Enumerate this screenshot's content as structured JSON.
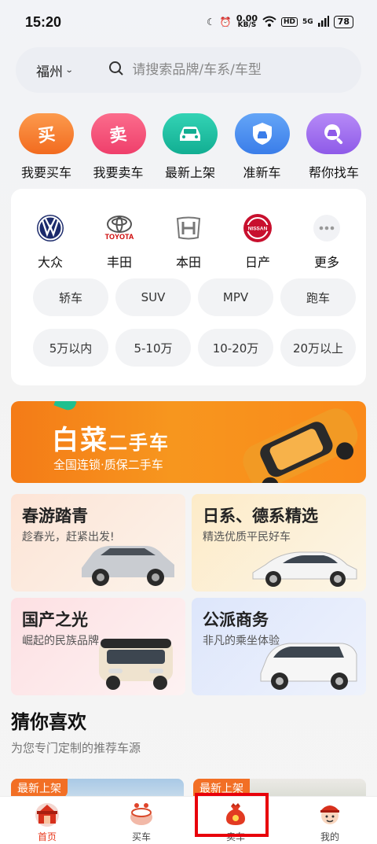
{
  "status": {
    "time": "15:20",
    "speed_value": "0.00",
    "speed_unit": "KB/S",
    "hd": "HD",
    "network": "5G",
    "battery": "78"
  },
  "search": {
    "city": "福州",
    "placeholder": "请搜索品牌/车系/车型"
  },
  "quick_actions": [
    {
      "label": "我要买车",
      "glyph": "买",
      "color": "#f7853a"
    },
    {
      "label": "我要卖车",
      "glyph": "卖",
      "color": "#f2557a"
    },
    {
      "label": "最新上架",
      "glyph": "car-icon",
      "color": "#1ec2a4"
    },
    {
      "label": "准新车",
      "glyph": "shield-car-icon",
      "color": "#4a8ff2"
    },
    {
      "label": "帮你找车",
      "glyph": "search-car-icon",
      "color": "#a06af0"
    }
  ],
  "brands": [
    {
      "label": "大众",
      "logo": "volkswagen-logo"
    },
    {
      "label": "丰田",
      "logo": "toyota-logo",
      "logo_text": "TOYOTA"
    },
    {
      "label": "本田",
      "logo": "honda-logo"
    },
    {
      "label": "日产",
      "logo": "nissan-logo",
      "logo_text": "NISSAN"
    },
    {
      "label": "更多",
      "logo": "more-icon"
    }
  ],
  "filters": [
    "轿车",
    "SUV",
    "MPV",
    "跑车",
    "5万以内",
    "5-10万",
    "10-20万",
    "20万以上"
  ],
  "banner": {
    "title_main": "白菜",
    "title_tail": "二手车",
    "subtitle": "全国连锁·质保二手车"
  },
  "feature_cards": [
    {
      "title": "春游踏青",
      "subtitle": "趁春光，赶紧出发!",
      "bg": "#fbeee4"
    },
    {
      "title": "日系、德系精选",
      "subtitle": "精选优质平民好车",
      "bg": "#fdf2dc"
    },
    {
      "title": "国产之光",
      "subtitle": "崛起的民族品牌",
      "bg": "#fde7e9"
    },
    {
      "title": "公派商务",
      "subtitle": "非凡的乘坐体验",
      "bg": "#e6ecfb"
    }
  ],
  "guess": {
    "title": "猜你喜欢",
    "subtitle": "为您专门定制的推荐车源"
  },
  "recommendations": [
    {
      "tag": "最新上架"
    },
    {
      "tag": "最新上架"
    }
  ],
  "tabs": [
    {
      "label": "首页",
      "icon": "home-icon",
      "active": true
    },
    {
      "label": "买车",
      "icon": "buy-car-icon",
      "active": false
    },
    {
      "label": "卖车",
      "icon": "money-bag-icon",
      "active": false
    },
    {
      "label": "我的",
      "icon": "profile-icon",
      "active": false
    }
  ]
}
